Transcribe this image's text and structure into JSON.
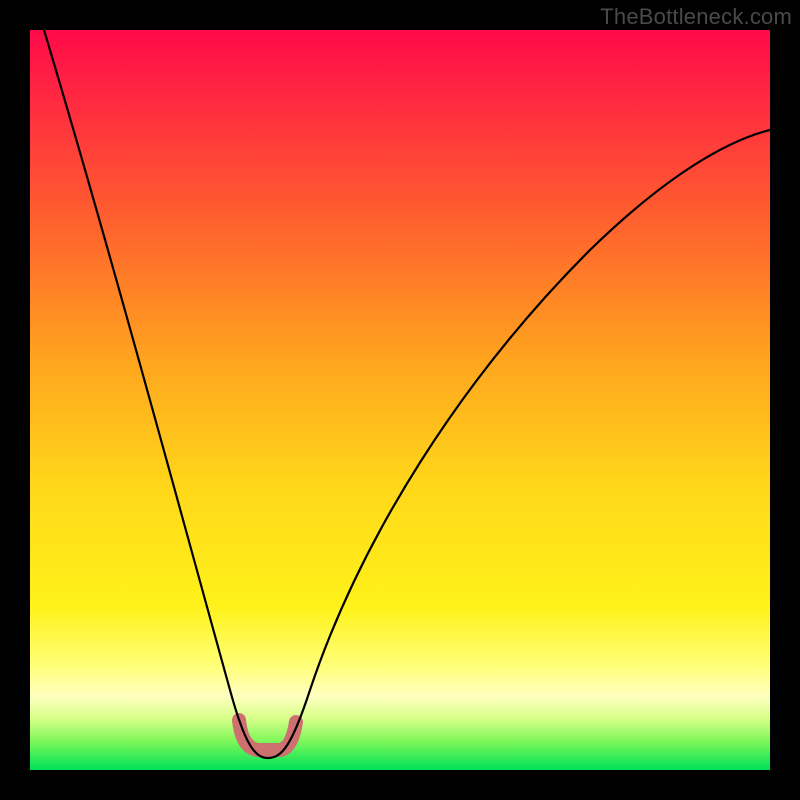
{
  "watermark": "TheBottleneck.com",
  "colors": {
    "gradient_top": "#ff0a4a",
    "gradient_upper_mid": "#ff6a2a",
    "gradient_mid": "#ffb21a",
    "gradient_lower_mid": "#ffe31a",
    "gradient_pale_yellow": "#ffff9a",
    "gradient_lime": "#9aff50",
    "gradient_bottom": "#00e05a",
    "curve": "#000000",
    "vertex_outline": "#cf7070",
    "frame": "#000000"
  },
  "chart_data": {
    "type": "line",
    "title": "",
    "xlabel": "",
    "ylabel": "",
    "x_range": [
      0,
      100
    ],
    "y_range": [
      0,
      100
    ],
    "series": [
      {
        "name": "bottleneck-curve",
        "x": [
          2,
          8,
          14,
          20,
          24,
          27,
          29,
          30.5,
          32,
          34,
          36,
          40,
          46,
          54,
          62,
          72,
          84,
          96,
          100
        ],
        "y": [
          100,
          75,
          52,
          32,
          18,
          9,
          4,
          2,
          2,
          4,
          8,
          15,
          25,
          38,
          50,
          62,
          73,
          80,
          82
        ]
      }
    ],
    "annotations": [
      {
        "name": "optimal-region-highlight",
        "x_start": 28,
        "x_end": 35,
        "y_level": 2.5
      }
    ],
    "notes": "Values estimated from pixel positions; chart has no visible axis tick labels."
  }
}
